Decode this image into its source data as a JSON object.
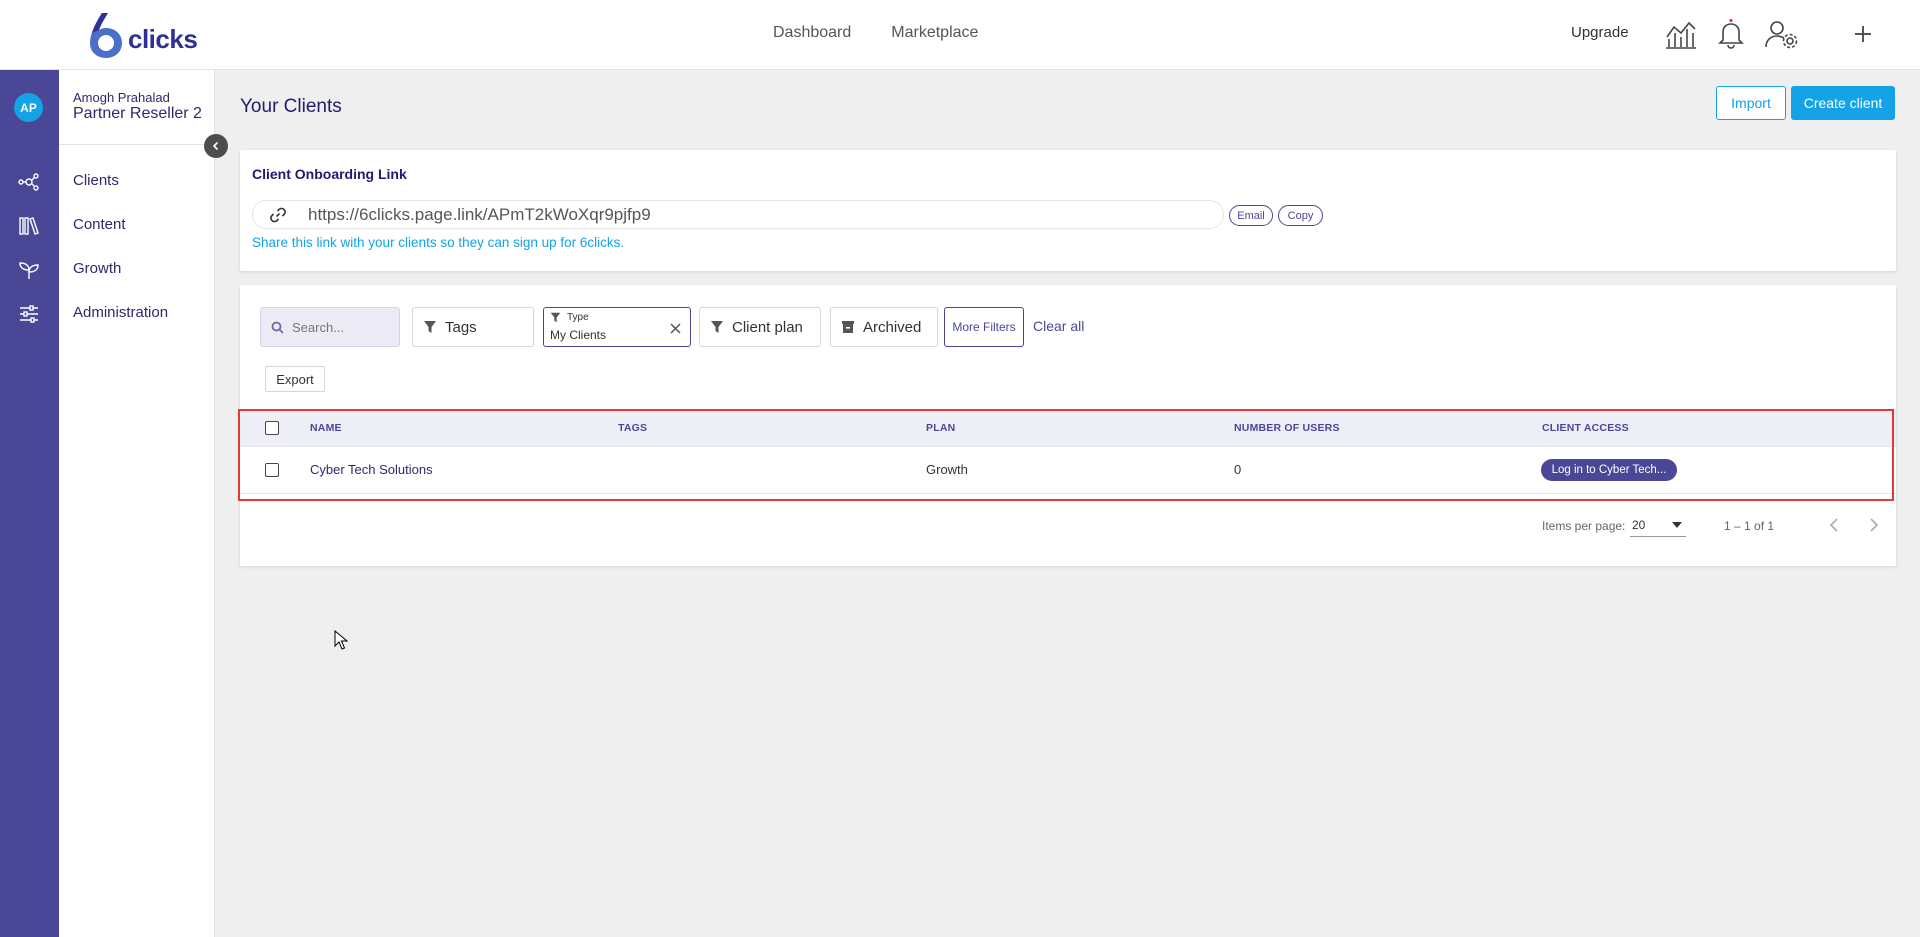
{
  "app": {
    "logo_text": "clicks",
    "logo_digit": "6"
  },
  "topnav": {
    "items": [
      "Dashboard",
      "Marketplace"
    ],
    "upgrade_label": "Upgrade"
  },
  "user": {
    "initials": "AP",
    "name": "Amogh Prahalad",
    "role": "Partner Reseller 2"
  },
  "sidebar": {
    "items": [
      {
        "label": "Clients",
        "icon": "network-icon"
      },
      {
        "label": "Content",
        "icon": "library-icon"
      },
      {
        "label": "Growth",
        "icon": "sprout-icon"
      },
      {
        "label": "Administration",
        "icon": "sliders-icon"
      }
    ]
  },
  "page": {
    "title": "Your Clients",
    "import_label": "Import",
    "create_label": "Create client"
  },
  "onboarding": {
    "title": "Client Onboarding Link",
    "link": "https://6clicks.page.link/APmT2kWoXqr9pjfp9",
    "email_label": "Email",
    "copy_label": "Copy",
    "share_text": "Share this link with your clients so they can sign up for 6clicks."
  },
  "filters": {
    "search_placeholder": "Search...",
    "tags_label": "Tags",
    "type_label": "Type",
    "type_value": "My Clients",
    "client_plan_label": "Client plan",
    "archived_label": "Archived",
    "more_filters_label": "More Filters",
    "clear_all_label": "Clear all",
    "export_label": "Export"
  },
  "table": {
    "headers": [
      "NAME",
      "TAGS",
      "PLAN",
      "NUMBER OF USERS",
      "CLIENT ACCESS"
    ],
    "rows": [
      {
        "name": "Cyber Tech Solutions",
        "tags": "",
        "plan": "Growth",
        "users": "0",
        "access_label": "Log in to Cyber Tech..."
      }
    ]
  },
  "pagination": {
    "items_per_page_label": "Items per page:",
    "items_per_page_value": "20",
    "range": "1 – 1 of 1"
  },
  "colors": {
    "brand": "#4a4896",
    "accent": "#13a3e6",
    "highlight": "#e53935"
  }
}
